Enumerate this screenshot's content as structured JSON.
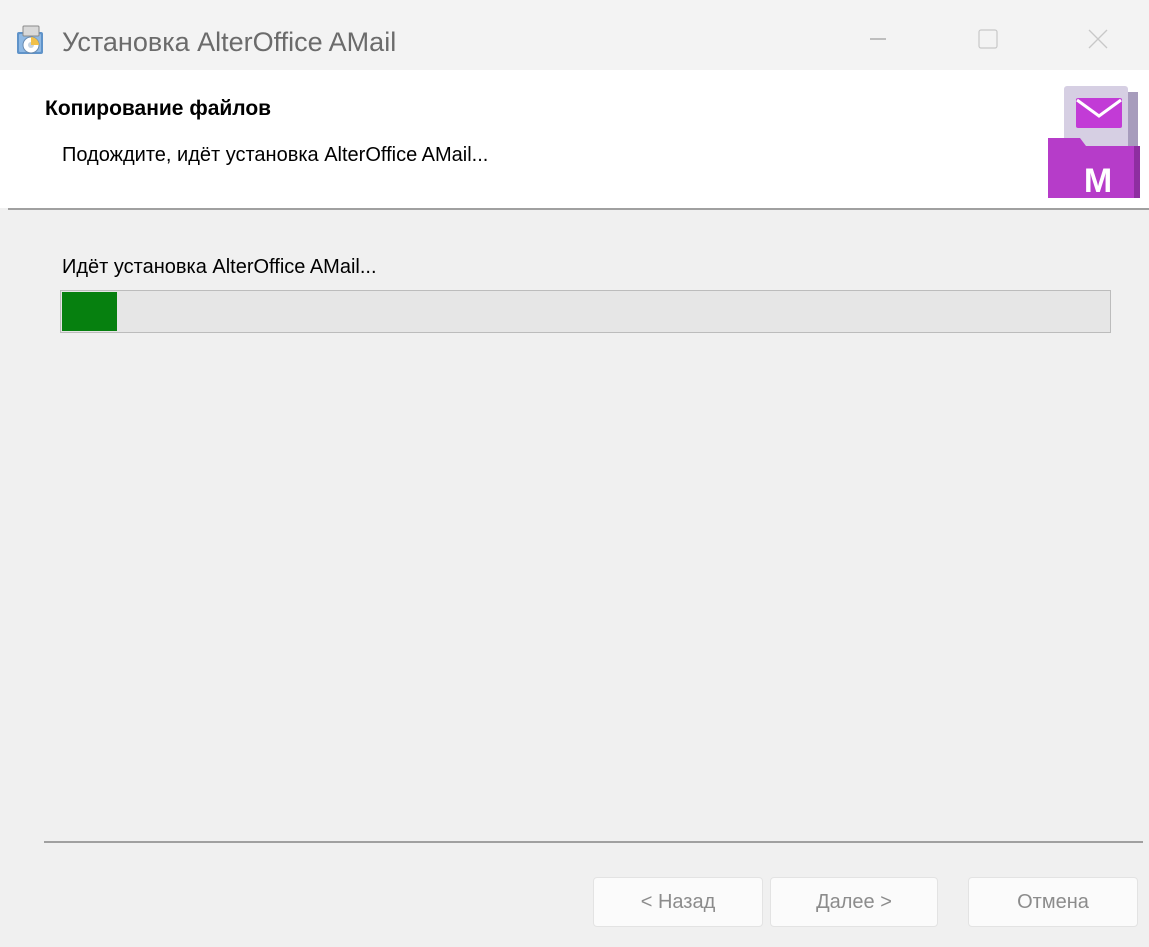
{
  "window": {
    "title": "Установка AlterOffice AMail",
    "icons": {
      "app": "installer-icon",
      "minimize": "minimize-icon",
      "maximize": "maximize-icon",
      "close": "close-icon"
    }
  },
  "banner": {
    "title": "Копирование файлов",
    "subtitle": "Подождите, идёт установка AlterOffice AMail...",
    "logo_icon": "amail-logo-icon",
    "logo_letter": "M"
  },
  "body": {
    "status": "Идёт установка AlterOffice AMail...",
    "progress": 0.053
  },
  "buttons": {
    "back": "< Назад",
    "next": "Далее >",
    "cancel": "Отмена"
  },
  "colors": {
    "progress_fill": "#06800f",
    "logo_purple": "#b63cc9",
    "button_text_disabled": "#8c8c8c"
  }
}
